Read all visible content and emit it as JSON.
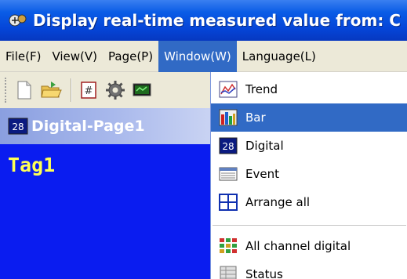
{
  "window": {
    "title": "Display real-time measured value from: C"
  },
  "menubar": {
    "items": [
      {
        "label": "File(F)",
        "active": false
      },
      {
        "label": "View(V)",
        "active": false
      },
      {
        "label": "Page(P)",
        "active": false
      },
      {
        "label": "Window(W)",
        "active": true
      },
      {
        "label": "Language(L)",
        "active": false
      }
    ]
  },
  "toolbar": {
    "buttons": [
      "new-page-icon",
      "open-folder-icon",
      "digital-icon",
      "settings-gear-icon",
      "monitor-icon"
    ]
  },
  "child_window": {
    "title": "Digital-Page1",
    "tag": "Tag1",
    "background_color": "#0a1cf0",
    "tag_color": "#ffff55"
  },
  "window_menu": {
    "items": [
      {
        "label": "Trend",
        "icon": "trend-icon",
        "selected": false
      },
      {
        "label": "Bar",
        "icon": "bar-chart-icon",
        "selected": true
      },
      {
        "label": "Digital",
        "icon": "digital-icon",
        "selected": false
      },
      {
        "label": "Event",
        "icon": "event-icon",
        "selected": false
      },
      {
        "label": "Arrange all",
        "icon": "arrange-all-icon",
        "selected": false
      },
      {
        "label": "All channel digital",
        "icon": "all-channel-digital-icon",
        "selected": false
      },
      {
        "label": "Status",
        "icon": "status-icon",
        "selected": false
      }
    ]
  },
  "colors": {
    "title_bar": "#0545d8",
    "menu_highlight": "#316ac5",
    "menu_background": "#ece9d8"
  }
}
